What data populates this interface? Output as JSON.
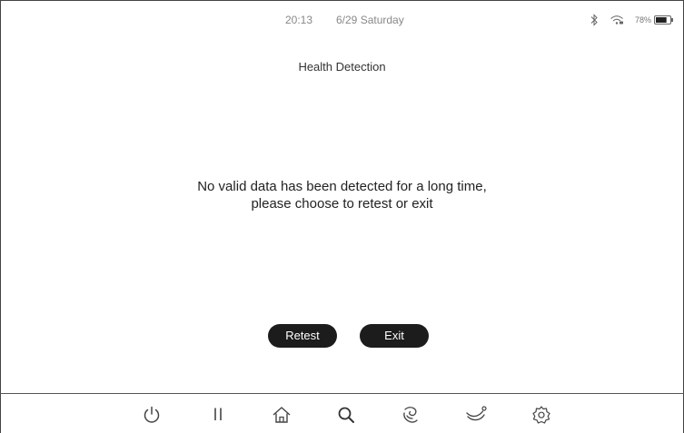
{
  "status": {
    "time": "20:13",
    "date": "6/29 Saturday",
    "battery_percent": "78%",
    "battery_level": 0.78,
    "icons": [
      "bluetooth-icon",
      "wifi-icon",
      "battery-icon"
    ]
  },
  "header": {
    "title": "Health Detection"
  },
  "main": {
    "message_line1": "No valid data has been detected for a long time,",
    "message_line2": "please choose to retest or exit"
  },
  "actions": {
    "retest_label": "Retest",
    "exit_label": "Exit"
  },
  "bottom_nav": {
    "icons": [
      "power-icon",
      "pause-icon",
      "home-icon",
      "search-icon",
      "massage-icon",
      "recline-icon",
      "settings-icon"
    ]
  },
  "colors": {
    "button_bg": "#1c1c1c",
    "button_text": "#ffffff",
    "status_text": "#888888"
  }
}
